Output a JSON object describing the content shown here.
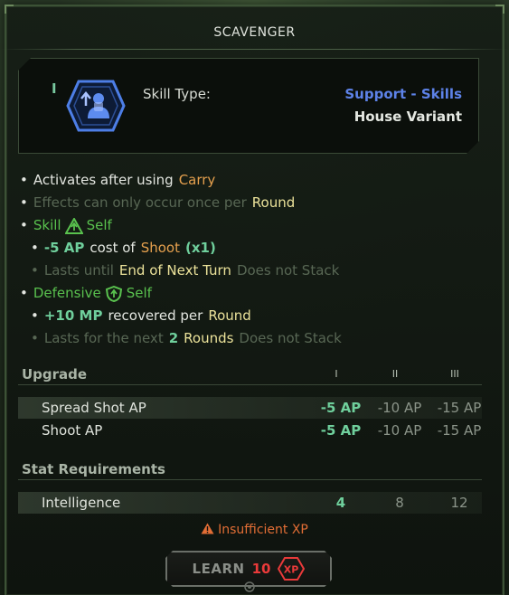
{
  "title": "SCAVENGER",
  "header": {
    "tier_mark": "I",
    "skill_type_label": "Skill Type:",
    "skill_type_value": "Support - Skills",
    "variant": "House Variant",
    "icon": "skill-icon"
  },
  "effects": {
    "l1_a": "Activates after using",
    "l1_b": "Carry",
    "l2_a": "Effects can only occur once per",
    "l2_b": "Round",
    "l3_a": "Skill",
    "l3_b": "Self",
    "l4_a": "-5 AP",
    "l4_b": "cost of",
    "l4_c": "Shoot",
    "l4_d": "(x1)",
    "l5_a": "Lasts until",
    "l5_b": "End of Next Turn",
    "l5_c": "Does not Stack",
    "l6_a": "Defensive",
    "l6_b": "Self",
    "l7_a": "+10 MP",
    "l7_b": "recovered per",
    "l7_c": "Round",
    "l8_a": "Lasts for the next",
    "l8_b": "2",
    "l8_c": "Rounds",
    "l8_d": "Does not Stack"
  },
  "upgrade": {
    "heading": "Upgrade",
    "tiers": [
      "I",
      "II",
      "III"
    ],
    "rows": [
      {
        "label": "Spread Shot AP",
        "values": [
          "-5 AP",
          "-10 AP",
          "-15 AP"
        ]
      },
      {
        "label": "Shoot AP",
        "values": [
          "-5 AP",
          "-10 AP",
          "-15 AP"
        ]
      }
    ]
  },
  "requirements": {
    "heading": "Stat Requirements",
    "rows": [
      {
        "label": "Intelligence",
        "values": [
          "4",
          "8",
          "12"
        ]
      }
    ]
  },
  "warning": "Insufficient XP",
  "learn": {
    "label": "LEARN",
    "cost": "10",
    "currency_icon": "xp-icon",
    "currency_text": "XP"
  },
  "colors": {
    "accent_blue": "#5d82e8",
    "green": "#59c14e",
    "teal": "#6fcf9c",
    "orange": "#e5a04e",
    "yellow": "#ebe29a",
    "warning": "#e16d35",
    "cost_red": "#ea3a3a"
  }
}
